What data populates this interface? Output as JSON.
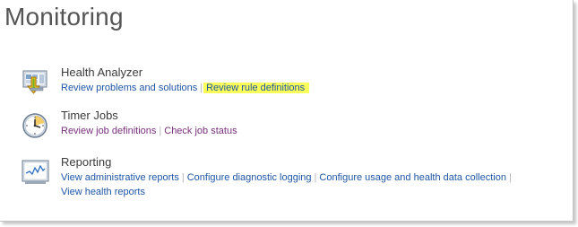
{
  "page": {
    "title": "Monitoring"
  },
  "colors": {
    "link": "#1f56a6",
    "visited_link": "#7a2f7e",
    "highlight": "#fbff5a"
  },
  "sections": [
    {
      "heading": "Health Analyzer",
      "icon": "health-analyzer-icon",
      "links": [
        "Review problems and solutions",
        "Review rule definitions"
      ]
    },
    {
      "heading": "Timer Jobs",
      "icon": "clock-icon",
      "links": [
        "Review job definitions",
        "Check job status"
      ]
    },
    {
      "heading": "Reporting",
      "icon": "report-icon",
      "links": [
        "View administrative reports",
        "Configure diagnostic logging",
        "Configure usage and health data collection",
        "View health reports"
      ]
    }
  ]
}
